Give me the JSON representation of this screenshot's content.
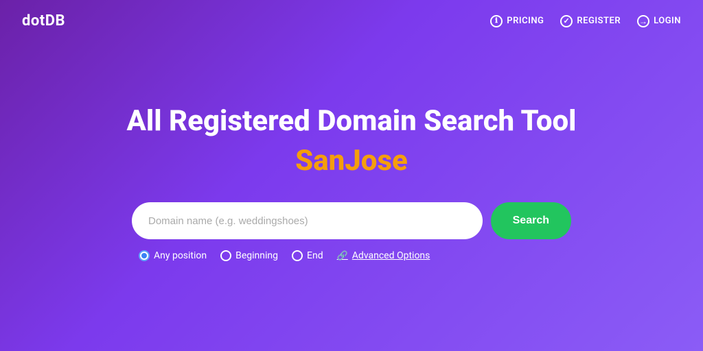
{
  "logo": {
    "text": "dotDB"
  },
  "nav": {
    "items": [
      {
        "id": "pricing",
        "label": "PRICING",
        "icon": "ℹ",
        "icon_type": "circle-i"
      },
      {
        "id": "register",
        "label": "REGISTER",
        "icon": "✓",
        "icon_type": "circle-check"
      },
      {
        "id": "login",
        "label": "LOGIN",
        "icon": "→",
        "icon_type": "arrow"
      }
    ]
  },
  "hero": {
    "title": "All Registered Domain Search Tool",
    "subtitle": "SanJose"
  },
  "search": {
    "placeholder": "Domain name (e.g. weddingshoes)",
    "button_label": "Search"
  },
  "search_options": {
    "items": [
      {
        "id": "any",
        "label": "Any position",
        "selected": true
      },
      {
        "id": "beginning",
        "label": "Beginning",
        "selected": false
      },
      {
        "id": "end",
        "label": "End",
        "selected": false
      }
    ],
    "advanced_label": "Advanced Options"
  }
}
